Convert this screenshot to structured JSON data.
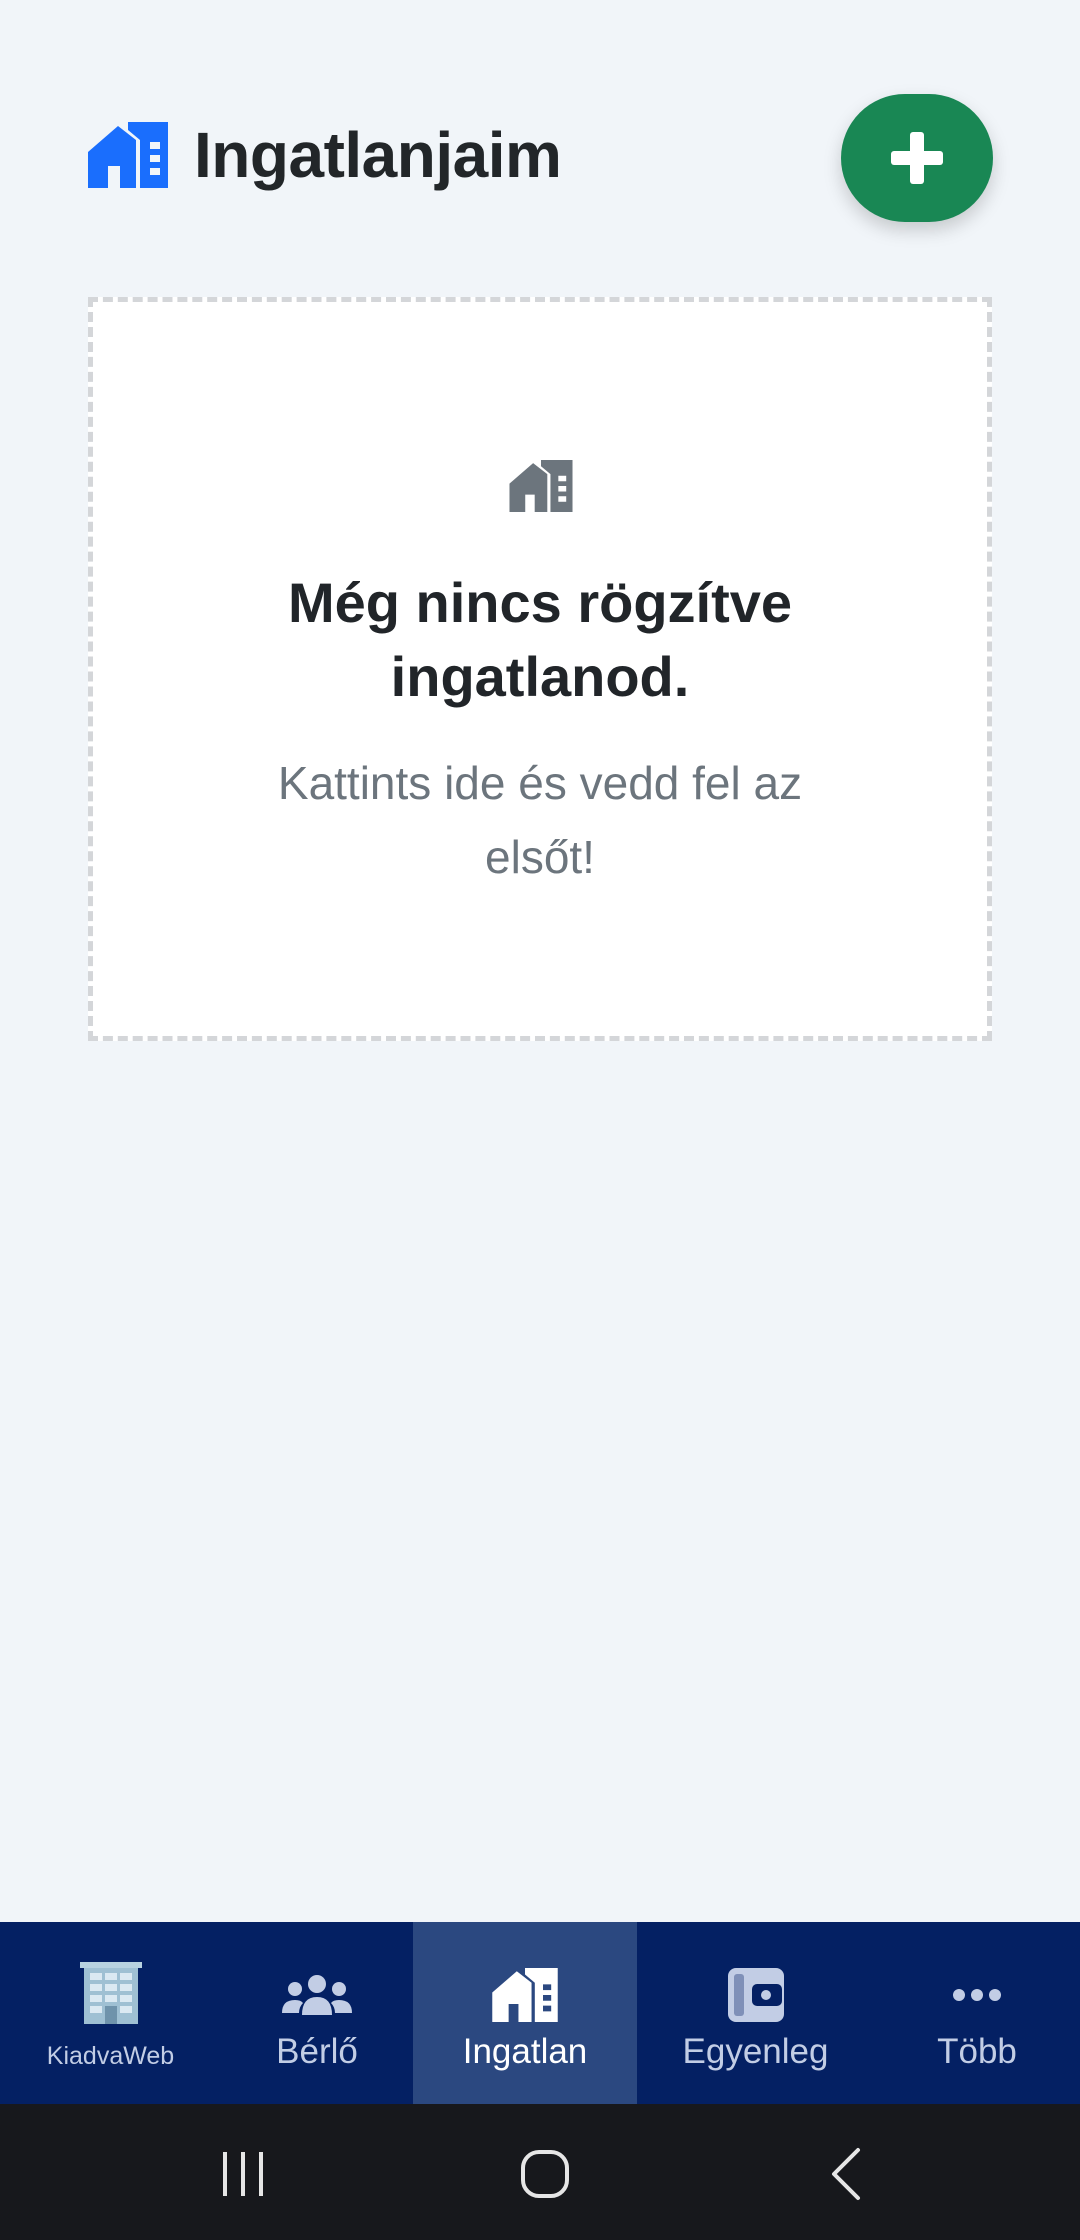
{
  "header": {
    "title": "Ingatlanjaim",
    "icon": "house-icon",
    "add_icon": "plus-icon"
  },
  "empty_state": {
    "icon": "house-icon",
    "title": "Még nincs rögzítve ingatlanod.",
    "subtitle": "Kattints ide és vedd fel az elsőt!"
  },
  "bottom_nav": {
    "items": [
      {
        "label": "KiadvaWeb",
        "icon": "building-logo-icon",
        "active": false
      },
      {
        "label": "Bérlő",
        "icon": "users-icon",
        "active": false
      },
      {
        "label": "Ingatlan",
        "icon": "house-icon",
        "active": true
      },
      {
        "label": "Egyenleg",
        "icon": "wallet-icon",
        "active": false
      },
      {
        "label": "Több",
        "icon": "more-dots-icon",
        "active": false
      }
    ]
  },
  "system_nav": {
    "buttons": [
      "recent-apps-icon",
      "home-icon",
      "back-icon"
    ]
  },
  "colors": {
    "background": "#f1f5f9",
    "accent_blue": "#1a6efd",
    "add_button": "#198754",
    "nav_background": "#042063",
    "nav_active": "#2b4880",
    "system_bar": "#17181c"
  }
}
